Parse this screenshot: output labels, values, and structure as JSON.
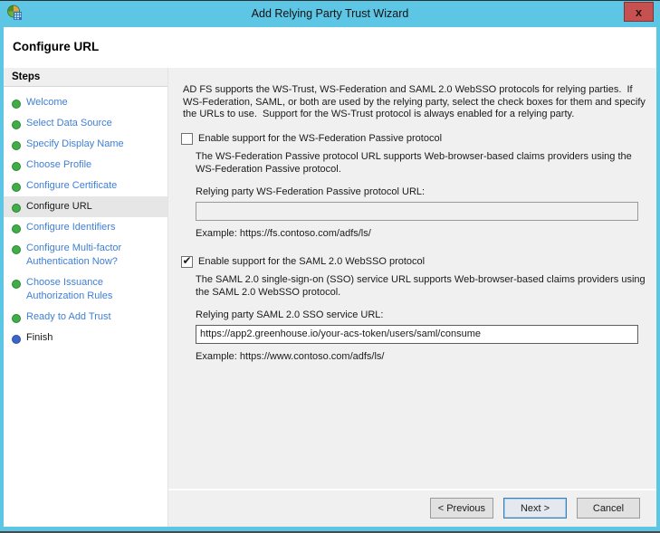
{
  "window": {
    "title": "Add Relying Party Trust Wizard",
    "close_glyph": "x"
  },
  "header": {
    "title": "Configure URL"
  },
  "sidebar": {
    "heading": "Steps",
    "items": [
      {
        "label": "Welcome",
        "state": "done"
      },
      {
        "label": "Select Data Source",
        "state": "done"
      },
      {
        "label": "Specify Display Name",
        "state": "done"
      },
      {
        "label": "Choose Profile",
        "state": "done"
      },
      {
        "label": "Configure Certificate",
        "state": "done"
      },
      {
        "label": "Configure URL",
        "state": "current"
      },
      {
        "label": "Configure Identifiers",
        "state": "done"
      },
      {
        "label": "Configure Multi-factor Authentication Now?",
        "state": "done"
      },
      {
        "label": "Choose Issuance Authorization Rules",
        "state": "done"
      },
      {
        "label": "Ready to Add Trust",
        "state": "done"
      },
      {
        "label": "Finish",
        "state": "pending"
      }
    ]
  },
  "content": {
    "intro": "AD FS supports the WS-Trust, WS-Federation and SAML 2.0 WebSSO protocols for relying parties.  If WS-Federation, SAML, or both are used by the relying party, select the check boxes for them and specify the URLs to use.  Support for the WS-Trust protocol is always enabled for a relying party.",
    "wsfed": {
      "checkbox_label": "Enable support for the WS-Federation Passive protocol",
      "checked": false,
      "description": "The WS-Federation Passive protocol URL supports Web-browser-based claims providers using the WS-Federation Passive protocol.",
      "url_label": "Relying party WS-Federation Passive protocol URL:",
      "url_value": "",
      "example": "Example: https://fs.contoso.com/adfs/ls/"
    },
    "saml": {
      "checkbox_label": "Enable support for the SAML 2.0 WebSSO protocol",
      "checked": true,
      "description": "The SAML 2.0 single-sign-on (SSO) service URL supports Web-browser-based claims providers using the SAML 2.0 WebSSO protocol.",
      "url_label": "Relying party SAML 2.0 SSO service URL:",
      "url_value": "https://app2.greenhouse.io/your-acs-token/users/saml/consume",
      "example": "Example: https://www.contoso.com/adfs/ls/"
    }
  },
  "footer": {
    "previous_label": "< Previous",
    "next_label": "Next >",
    "cancel_label": "Cancel"
  },
  "icons": {
    "check_glyph": "✔"
  },
  "colors": {
    "titlebar": "#5DC6E5",
    "close_bg": "#C75050",
    "link": "#3F7FD6",
    "step_done": "#3FAE46",
    "step_pending": "#3A66C8"
  }
}
